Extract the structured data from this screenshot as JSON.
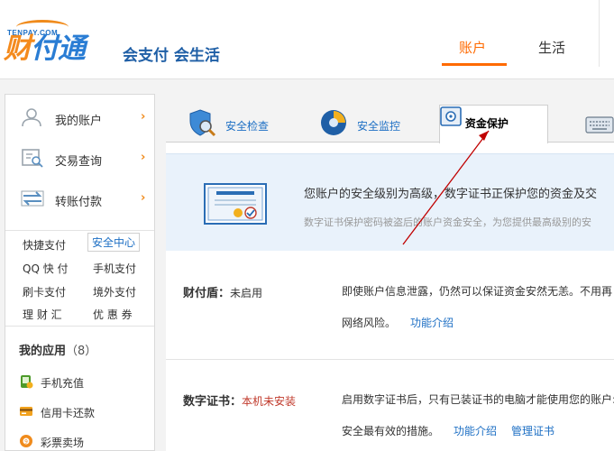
{
  "header": {
    "logo_small": "TENPAY.COM",
    "logo_main_1": "财",
    "logo_main_2": "付通",
    "slogan": "会支付 会生活",
    "nav": [
      "账户",
      "生活"
    ]
  },
  "sidebar": {
    "items": [
      {
        "label": "我的账户",
        "icon": "user-icon"
      },
      {
        "label": "交易查询",
        "icon": "search-list-icon"
      },
      {
        "label": "转账付款",
        "icon": "transfer-icon"
      }
    ],
    "quick_links": [
      "快捷支付",
      "安全中心",
      "QQ 快 付",
      "手机支付",
      "刷卡支付",
      "境外支付",
      "理 财 汇",
      "优 惠 券"
    ],
    "apps_title": "我的应用",
    "apps_count": "（8）",
    "apps": [
      {
        "label": "手机充值",
        "icon": "phone-topup-icon"
      },
      {
        "label": "信用卡还款",
        "icon": "credit-card-icon"
      },
      {
        "label": "彩票卖场",
        "icon": "lottery-icon"
      }
    ]
  },
  "tabs": [
    {
      "label": "安全检查",
      "icon": "shield-check-icon"
    },
    {
      "label": "安全监控",
      "icon": "monitor-icon"
    },
    {
      "label": "资金保护",
      "icon": "safe-icon"
    }
  ],
  "notice": {
    "main": "您账户的安全级别为高级，数字证书正保护您的资金及交",
    "sub": "数字证书保护密码被盗后的账户资金安全，为您提供最高级别的安"
  },
  "rows": {
    "shield_label": "财付盾：",
    "shield_status": "未启用",
    "shield_desc_1": "即使账户信息泄露，仍然可以保证资金安然无恙。不用再",
    "shield_desc_2": "网络风险。",
    "shield_link": "功能介绍",
    "cert_label": "数字证书：",
    "cert_status": "本机未安装",
    "cert_desc_1": "启用数字证书后，只有已装证书的电脑才能使用您的账户:",
    "cert_desc_2": "安全最有效的措施。",
    "cert_link_1": "功能介绍",
    "cert_link_2": "管理证书"
  },
  "colors": {
    "accent": "#ff6a00",
    "link": "#1d6fc4",
    "annotation_arrow": "#c00000"
  }
}
